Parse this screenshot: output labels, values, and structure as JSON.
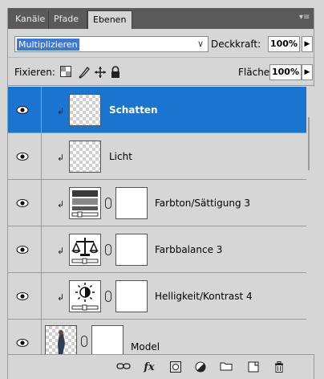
{
  "tabs": [
    {
      "label": "Kanäle",
      "active": false
    },
    {
      "label": "Pfade",
      "active": false
    },
    {
      "label": "Ebenen",
      "active": true
    }
  ],
  "tab_menu_icon": "panel-menu-icon",
  "blend": {
    "mode": "Multiplizieren",
    "opacity_label": "Deckkraft:",
    "opacity_value": "100%"
  },
  "lock": {
    "label": "Fixieren:",
    "icons": [
      "lock-transparency-icon",
      "lock-image-icon",
      "lock-position-icon",
      "lock-all-icon"
    ],
    "fill_label": "Fläche:",
    "fill_value": "100%"
  },
  "layers": [
    {
      "name": "Schatten",
      "type": "pixel",
      "selected": true,
      "clipped": true
    },
    {
      "name": "Licht",
      "type": "pixel",
      "selected": false,
      "clipped": true
    },
    {
      "name": "Farbton/Sättigung 3",
      "type": "adjustment",
      "adjustment_icon": "hue-saturation-icon",
      "selected": false,
      "clipped": true
    },
    {
      "name": "Farbbalance 3",
      "type": "adjustment",
      "adjustment_icon": "color-balance-icon",
      "selected": false,
      "clipped": true
    },
    {
      "name": "Helligkeit/Kontrast 4",
      "type": "adjustment",
      "adjustment_icon": "brightness-contrast-icon",
      "selected": false,
      "clipped": true
    },
    {
      "name": "Model",
      "type": "pixel-with-mask",
      "selected": false,
      "clipped": false
    }
  ],
  "bottom_tools": [
    "link-layers-icon",
    "fx-icon",
    "add-mask-icon",
    "new-adjustment-icon",
    "new-group-icon",
    "new-layer-icon",
    "trash-icon"
  ],
  "colors": {
    "selection": "#1a75d1",
    "tabbar": "#5a5a5a",
    "panel": "#d6d6d6",
    "blend_highlight": "#3d78d6"
  }
}
